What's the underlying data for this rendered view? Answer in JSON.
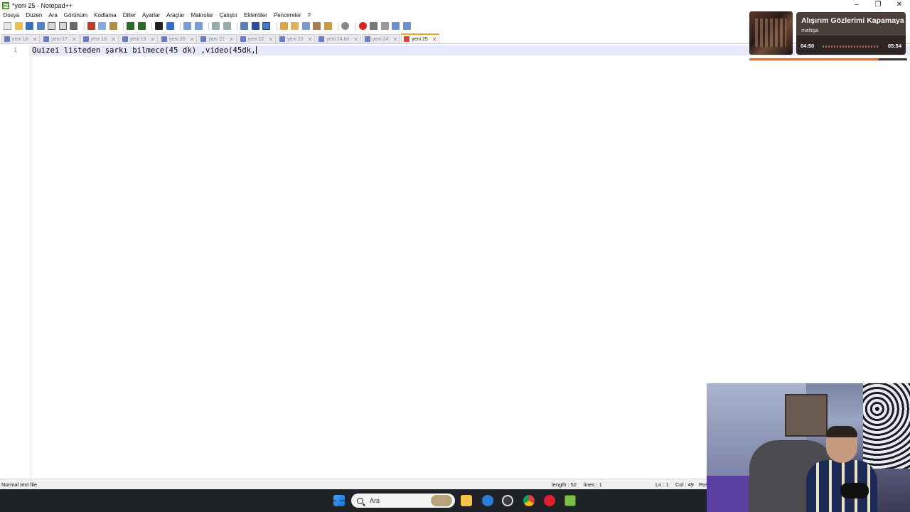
{
  "window": {
    "title": "*yeni 25 - Notepad++",
    "controls": [
      "–",
      "❐",
      "✕"
    ]
  },
  "menu": [
    "Dosya",
    "Düzen",
    "Ara",
    "Görünüm",
    "Kodlama",
    "Diller",
    "Ayarlar",
    "Araçlar",
    "Makrolar",
    "Çalıştır",
    "Eklentiler",
    "Pencereler",
    "?"
  ],
  "tabs": [
    {
      "label": "yeni 16"
    },
    {
      "label": "yeni 17"
    },
    {
      "label": "yeni 18"
    },
    {
      "label": "yeni 19"
    },
    {
      "label": "yeni 20"
    },
    {
      "label": "yeni 21"
    },
    {
      "label": "yeni 22"
    },
    {
      "label": "yeni 23"
    },
    {
      "label": "yeni 24.txt"
    },
    {
      "label": "yeni 24"
    },
    {
      "label": "yeni 25",
      "active": true
    }
  ],
  "editor": {
    "line_number": "1",
    "content": "Quizei listeden şarkı bilmece(45 dk) ,video(45dk,"
  },
  "status": {
    "file_type": "Normal text file",
    "length": "length : 52",
    "lines": "lines : 1",
    "ln": "Ln : 1",
    "col": "Col : 49",
    "pos": "Pos"
  },
  "taskbar": {
    "search_placeholder": "Ara"
  },
  "now_playing": {
    "song": "Alışırım Gözlerimi Kapamaya",
    "artist": "maNga",
    "elapsed": "04:50",
    "duration": "05:54",
    "progress": 0.82
  },
  "colors": {
    "accent_tab": "#f3a02f",
    "line_highlight": "#e8e8ff",
    "taskbar": "#1f2328"
  }
}
